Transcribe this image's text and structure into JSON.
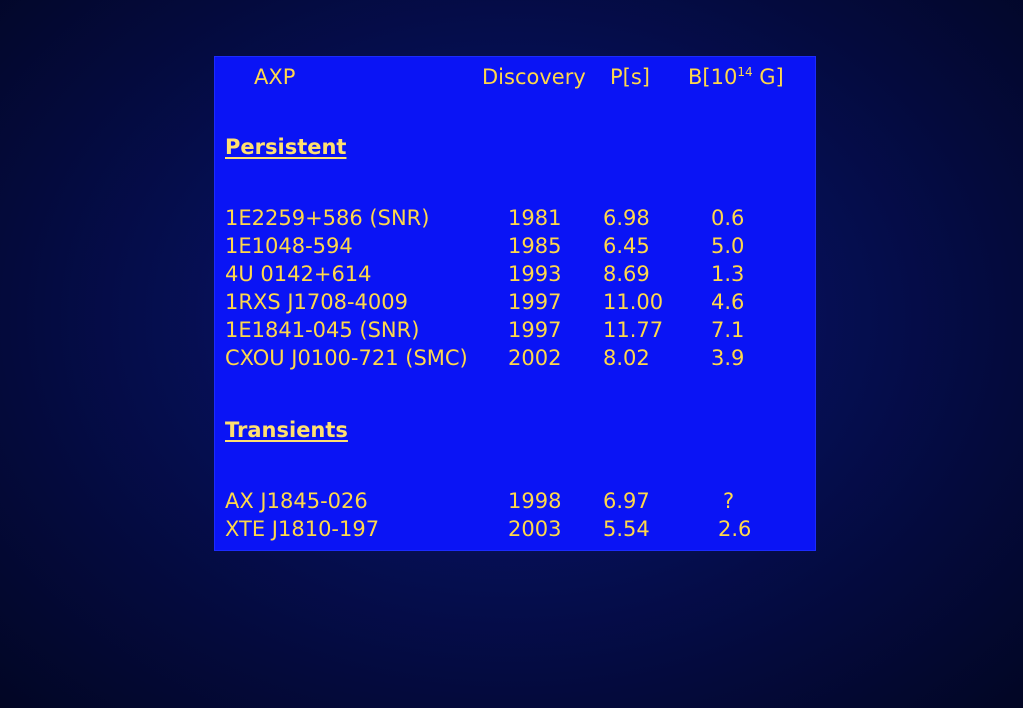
{
  "header": {
    "col_name": "AXP",
    "col_discovery": "Discovery",
    "col_period": "P[s]",
    "col_field_prefix": "B[10",
    "col_field_exp": "14",
    "col_field_suffix": " G]"
  },
  "sections": {
    "persistent": "Persistent",
    "transients": "Transients"
  },
  "persistent_rows": [
    {
      "name": "1E2259+586 (SNR)",
      "year": "1981",
      "period": "6.98",
      "field": "0.6"
    },
    {
      "name": "1E1048-594",
      "year": "1985",
      "period": "6.45",
      "field": "5.0"
    },
    {
      "name": "4U 0142+614",
      "year": "1993",
      "period": "8.69",
      "field": "1.3"
    },
    {
      "name": "1RXS J1708-4009",
      "year": "1997",
      "period": "11.00",
      "field": "4.6"
    },
    {
      "name": "1E1841-045 (SNR)",
      "year": "1997",
      "period": "11.77",
      "field": "7.1"
    },
    {
      "name": "CXOU J0100-721 (SMC)",
      "year": "2002",
      "period": "8.02",
      "field": "3.9"
    }
  ],
  "transient_rows": [
    {
      "name": "AX J1845-026",
      "year": "1998",
      "period": "6.97",
      "field": "?"
    },
    {
      "name": "XTE J1810-197",
      "year": "2003",
      "period": "5.54",
      "field": "2.6"
    }
  ],
  "colors": {
    "panel": "#0a14f5",
    "text": "#ffd84a",
    "background": "#040a3c"
  }
}
